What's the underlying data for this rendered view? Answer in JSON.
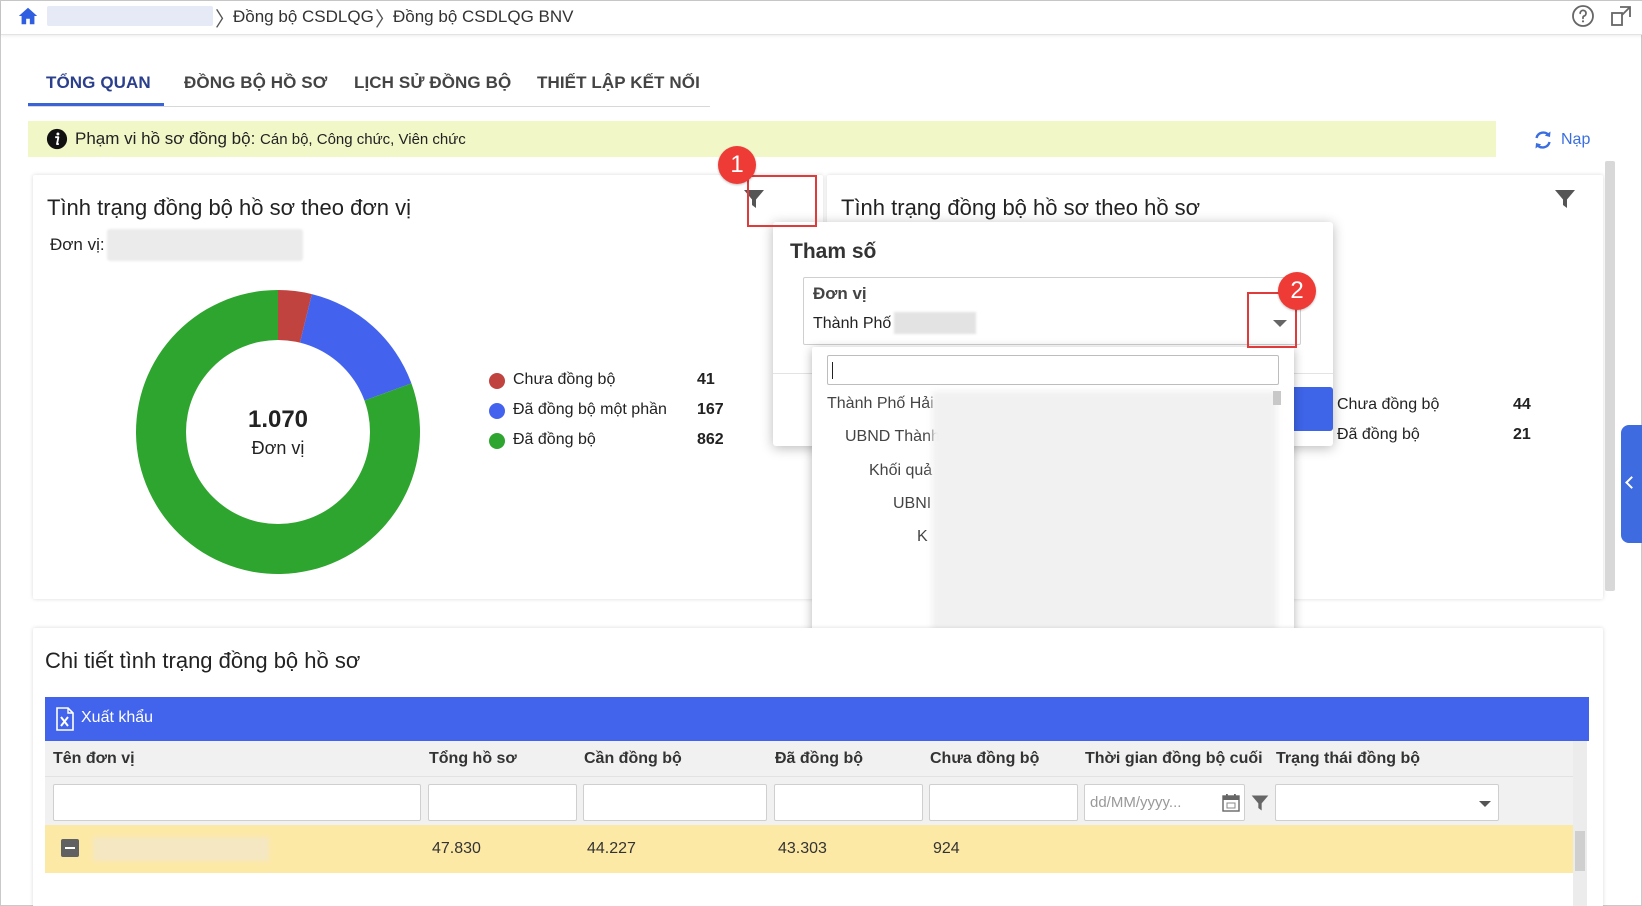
{
  "breadcrumb": {
    "items": [
      "Đồng bộ CSDLQG",
      "Đồng bộ CSDLQG BNV"
    ]
  },
  "tabs": [
    {
      "label": "TỔNG QUAN",
      "active": true
    },
    {
      "label": "ĐỒNG BỘ HỒ SƠ",
      "active": false
    },
    {
      "label": "LỊCH SỬ ĐỒNG BỘ",
      "active": false
    },
    {
      "label": "THIẾT LẬP KẾT NỐI",
      "active": false
    }
  ],
  "banner": {
    "label": "Phạm vi hồ sơ đồng bộ:",
    "value": "Cán bộ, Công chức, Viên chức"
  },
  "reload_label": "Nạp",
  "card_unit": {
    "title": "Tình trạng đồng bộ hồ sơ theo đơn vị",
    "unit_label": "Đơn vị:",
    "center_value": "1.070",
    "center_label": "Đơn vị"
  },
  "card_profile": {
    "title": "Tình trạng đồng bộ hồ sơ theo hồ sơ"
  },
  "chart_data": [
    {
      "type": "pie",
      "title": "Tình trạng đồng bộ hồ sơ theo đơn vị",
      "categories": [
        "Chưa đồng bộ",
        "Đã đồng bộ một phần",
        "Đã đồng bộ"
      ],
      "values": [
        41,
        167,
        862
      ],
      "values_text": [
        "41",
        "167",
        "862"
      ],
      "colors": [
        "#c0433f",
        "#4363ee",
        "#2ea52e"
      ],
      "legend": "right"
    },
    {
      "type": "pie",
      "title": "Tình trạng đồng bộ hồ sơ theo hồ sơ",
      "categories": [
        "Chưa đồng bộ",
        "Đã đồng bộ"
      ],
      "values": [
        44,
        21
      ],
      "values_text": [
        "44",
        "21"
      ],
      "colors": [
        "#c0433f",
        "#2ea52e"
      ],
      "legend": "right"
    }
  ],
  "callouts": [
    "1",
    "2"
  ],
  "popup": {
    "title": "Tham số",
    "field_label": "Đơn vị",
    "field_value": "Thành Phố"
  },
  "dropdown": {
    "search_value": "",
    "items": [
      "Thành Phố Hải",
      "UBND Thành",
      "Khối quả",
      "UBNI",
      "K"
    ]
  },
  "table": {
    "title": "Chi tiết tình trạng đồng bộ hồ sơ",
    "export_label": "Xuất khẩu",
    "columns": [
      "Tên đơn vị",
      "Tổng hồ sơ",
      "Cần đồng bộ",
      "Đã đồng bộ",
      "Chưa đồng bộ",
      "Thời gian đồng bộ cuối",
      "Trạng thái đồng bộ"
    ],
    "date_placeholder": "dd/MM/yyyy...",
    "rows": [
      {
        "total": "47.830",
        "need": "44.227",
        "synced": "43.303",
        "not_synced": "924"
      }
    ]
  },
  "colors": {
    "accent": "#4263eb",
    "banner_bg": "#f2f7c8",
    "row_highlight": "#fde9a6",
    "callout": "#ef3b36"
  }
}
